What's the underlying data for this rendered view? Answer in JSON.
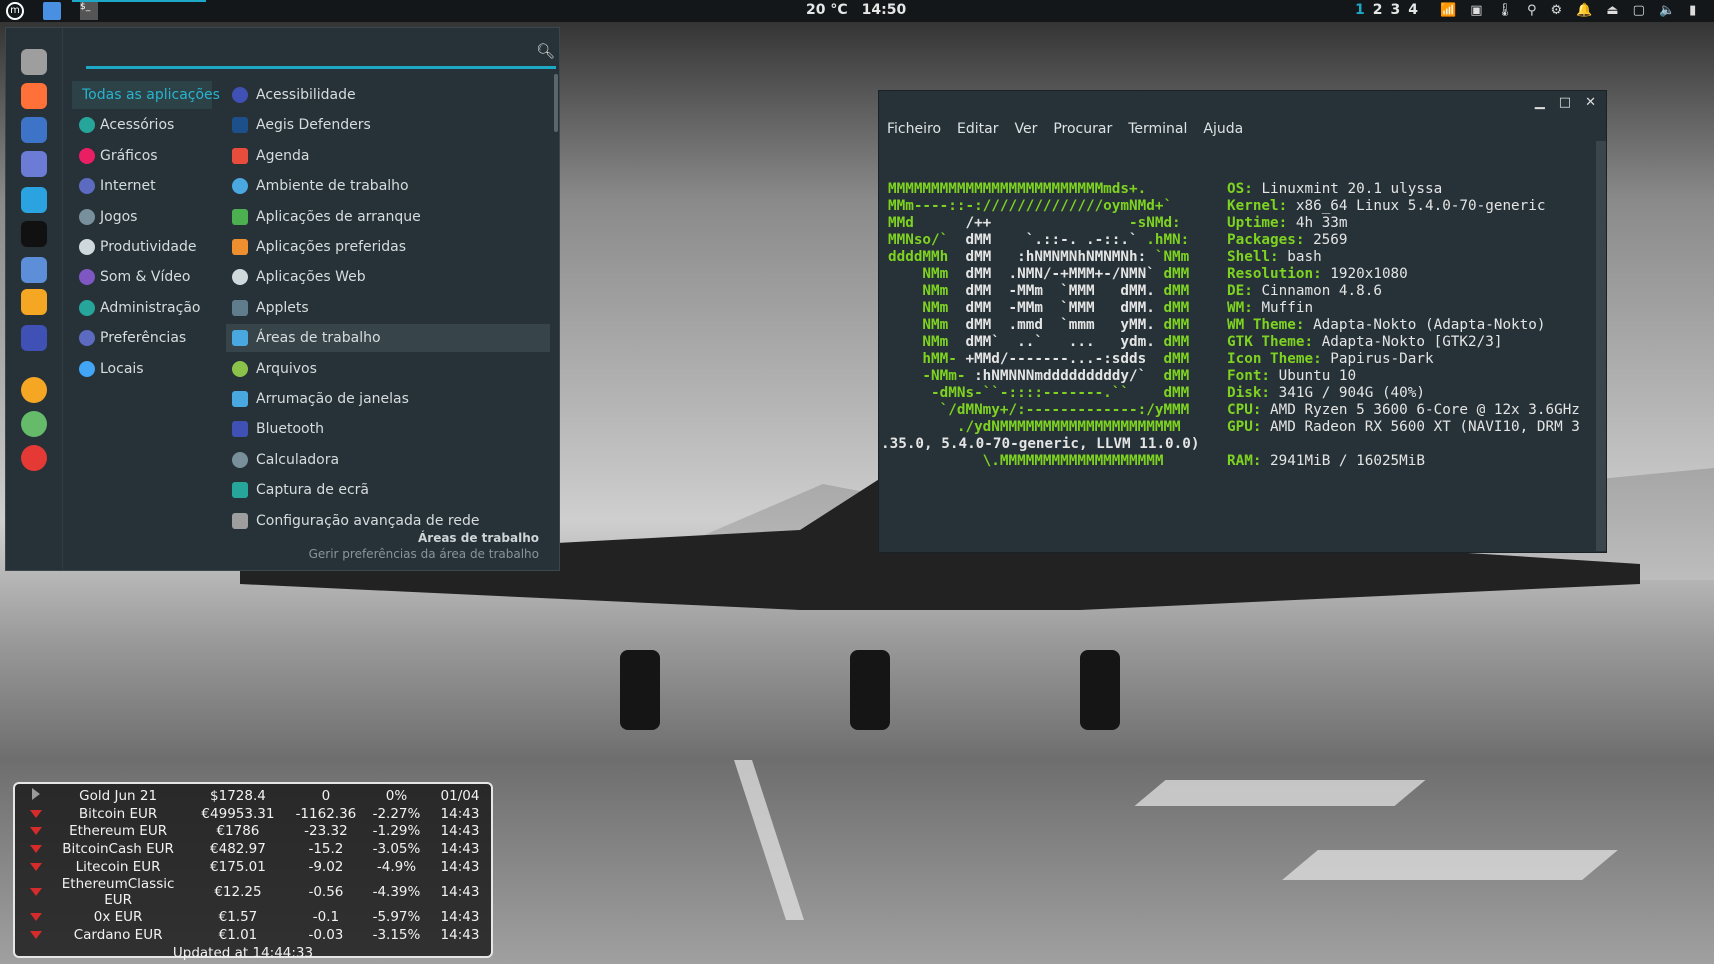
{
  "topbar": {
    "weather": "20 °C",
    "clock": "14:50",
    "workspaces": [
      "1",
      "2",
      "3",
      "4"
    ],
    "tray_icons": [
      "network-icon",
      "keyboard-icon",
      "temperature-icon",
      "location-icon",
      "steam-icon",
      "notifications-icon",
      "drive-icon",
      "display-icon",
      "volume-icon",
      "battery-icon"
    ],
    "accent": "#1ea8c8"
  },
  "menu": {
    "search_placeholder": "",
    "favorites": [
      "files-icon",
      "firefox-icon",
      "browser-icon",
      "mail-icon",
      "telegram-icon",
      "epic-games-icon",
      "store-icon",
      "ubuntu-sso-icon",
      "dice-icon",
      "lock-icon",
      "logout-icon",
      "shutdown-icon"
    ],
    "categories": [
      {
        "label": "Todas as aplicações",
        "icon": "all-apps-icon"
      },
      {
        "label": "Acessórios",
        "icon": "accessories-icon"
      },
      {
        "label": "Gráficos",
        "icon": "graphics-icon"
      },
      {
        "label": "Internet",
        "icon": "internet-icon"
      },
      {
        "label": "Jogos",
        "icon": "games-icon"
      },
      {
        "label": "Produtividade",
        "icon": "office-icon"
      },
      {
        "label": "Som & Vídeo",
        "icon": "multimedia-icon"
      },
      {
        "label": "Administração",
        "icon": "admin-icon"
      },
      {
        "label": "Preferências",
        "icon": "preferences-icon"
      },
      {
        "label": "Locais",
        "icon": "folder-icon"
      }
    ],
    "apps": [
      {
        "label": "Acessibilidade",
        "color": "#3f51b5"
      },
      {
        "label": "Aegis Defenders",
        "color": "#1d4f8a"
      },
      {
        "label": "Agenda",
        "color": "#e84c3d"
      },
      {
        "label": "Ambiente de trabalho",
        "color": "#4aa8e0"
      },
      {
        "label": "Aplicações de arranque",
        "color": "#4caf50"
      },
      {
        "label": "Aplicações preferidas",
        "color": "#ef8f2f"
      },
      {
        "label": "Aplicações Web",
        "color": "#cfd8dc"
      },
      {
        "label": "Applets",
        "color": "#607d8b"
      },
      {
        "label": "Áreas de trabalho",
        "color": "#4aa8e0"
      },
      {
        "label": "Arquivos",
        "color": "#8bc34a"
      },
      {
        "label": "Arrumação de janelas",
        "color": "#4aa8e0"
      },
      {
        "label": "Bluetooth",
        "color": "#3f51b5"
      },
      {
        "label": "Calculadora",
        "color": "#78909c"
      },
      {
        "label": "Captura de ecrã",
        "color": "#26a69a"
      },
      {
        "label": "Configuração avançada de rede",
        "color": "#9e9e9e"
      }
    ],
    "selected_app": "Áreas de trabalho",
    "description_title": "Áreas de trabalho",
    "description_text": "Gerir preferências da área de trabalho"
  },
  "terminal": {
    "menu": [
      "Ficheiro",
      "Editar",
      "Ver",
      "Procurar",
      "Terminal",
      "Ajuda"
    ],
    "logo": [
      [
        [
          "g",
          "MMMMMMMMMMMMMMMMMMMMMMMMMmds+."
        ]
      ],
      [
        [
          "g",
          "MMm----::-://////////////oymNMd+`"
        ]
      ],
      [
        [
          "g",
          "MMd      "
        ],
        [
          "w",
          "/++                "
        ],
        [
          "g",
          "-sNMd:"
        ]
      ],
      [
        [
          "g",
          "MMNso/`  "
        ],
        [
          "w",
          "dMM    `.::-. .-::.` "
        ],
        [
          "g",
          ".hMN:"
        ]
      ],
      [
        [
          "g",
          "ddddMMh  "
        ],
        [
          "w",
          "dMM   :hNMNMNhNMNMNh: "
        ],
        [
          "g",
          "`NMm"
        ]
      ],
      [
        [
          "g",
          "    NMm  "
        ],
        [
          "w",
          "dMM  .NMN/-+MMM+-/NMN` "
        ],
        [
          "g",
          "dMM"
        ]
      ],
      [
        [
          "g",
          "    NMm  "
        ],
        [
          "w",
          "dMM  -MMm  `MMM   dMM. "
        ],
        [
          "g",
          "dMM"
        ]
      ],
      [
        [
          "g",
          "    NMm  "
        ],
        [
          "w",
          "dMM  -MMm  `MMM   dMM. "
        ],
        [
          "g",
          "dMM"
        ]
      ],
      [
        [
          "g",
          "    NMm  "
        ],
        [
          "w",
          "dMM  .mmd  `mmm   yMM. "
        ],
        [
          "g",
          "dMM"
        ]
      ],
      [
        [
          "g",
          "    NMm  "
        ],
        [
          "w",
          "dMM`  ..`   ...   ydm. "
        ],
        [
          "g",
          "dMM"
        ]
      ],
      [
        [
          "g",
          "    hMM- "
        ],
        [
          "w",
          "+MMd/-------...-:sdds  "
        ],
        [
          "g",
          "dMM"
        ]
      ],
      [
        [
          "g",
          "    -NMm- "
        ],
        [
          "w",
          ":hNMNNNmdddddddddy/`  "
        ],
        [
          "g",
          "dMM"
        ]
      ],
      [
        [
          "g",
          "     -dMNs-``-::::-------.``    dMM"
        ]
      ],
      [
        [
          "g",
          "      `/dMNmy+/:-------------:/yMMM"
        ]
      ],
      [
        [
          "g",
          "        ./ydNMMMMMMMMMMMMMMMMMMMMM"
        ]
      ],
      [
        [
          "w",
          ".35.0, 5.4.0-70-generic, LLVM 11.0.0)"
        ]
      ],
      [
        [
          "g",
          "           \\.MMMMMMMMMMMMMMMMMMM"
        ]
      ]
    ],
    "info": [
      {
        "key": "OS:",
        "value": "Linuxmint 20.1 ulyssa"
      },
      {
        "key": "Kernel:",
        "value": "x86_64 Linux 5.4.0-70-generic"
      },
      {
        "key": "Uptime:",
        "value": "4h 33m"
      },
      {
        "key": "Packages:",
        "value": "2569"
      },
      {
        "key": "Shell:",
        "value": "bash"
      },
      {
        "key": "Resolution:",
        "value": "1920x1080"
      },
      {
        "key": "DE:",
        "value": "Cinnamon 4.8.6"
      },
      {
        "key": "WM:",
        "value": "Muffin"
      },
      {
        "key": "WM Theme:",
        "value": "Adapta-Nokto (Adapta-Nokto)"
      },
      {
        "key": "GTK Theme:",
        "value": "Adapta-Nokto [GTK2/3]"
      },
      {
        "key": "Icon Theme:",
        "value": "Papirus-Dark"
      },
      {
        "key": "Font:",
        "value": "Ubuntu 10"
      },
      {
        "key": "Disk:",
        "value": "341G / 904G (40%)"
      },
      {
        "key": "CPU:",
        "value": "AMD Ryzen 5 3600 6-Core @ 12x 3.6GHz"
      },
      {
        "key": "GPU:",
        "value": "AMD Radeon RX 5600 XT (NAVI10, DRM 3"
      },
      {
        "key": "",
        "value": ""
      },
      {
        "key": "RAM:",
        "value": "2941MiB / 16025MiB"
      }
    ]
  },
  "stocks": {
    "rows": [
      {
        "trend": "flat",
        "name": "Gold Jun 21",
        "price": "$1728.4",
        "change": "0",
        "pct": "0%",
        "time": "01/04"
      },
      {
        "trend": "down",
        "name": "Bitcoin EUR",
        "price": "€49953.31",
        "change": "-1162.36",
        "pct": "-2.27%",
        "time": "14:43"
      },
      {
        "trend": "down",
        "name": "Ethereum EUR",
        "price": "€1786",
        "change": "-23.32",
        "pct": "-1.29%",
        "time": "14:43"
      },
      {
        "trend": "down",
        "name": "BitcoinCash EUR",
        "price": "€482.97",
        "change": "-15.2",
        "pct": "-3.05%",
        "time": "14:43"
      },
      {
        "trend": "down",
        "name": "Litecoin EUR",
        "price": "€175.01",
        "change": "-9.02",
        "pct": "-4.9%",
        "time": "14:43"
      },
      {
        "trend": "down",
        "name": "EthereumClassic EUR",
        "price": "€12.25",
        "change": "-0.56",
        "pct": "-4.39%",
        "time": "14:43"
      },
      {
        "trend": "down",
        "name": "0x EUR",
        "price": "€1.57",
        "change": "-0.1",
        "pct": "-5.97%",
        "time": "14:43"
      },
      {
        "trend": "down",
        "name": "Cardano EUR",
        "price": "€1.01",
        "change": "-0.03",
        "pct": "-3.15%",
        "time": "14:43"
      }
    ],
    "updated": "Updated at 14:44:33"
  }
}
